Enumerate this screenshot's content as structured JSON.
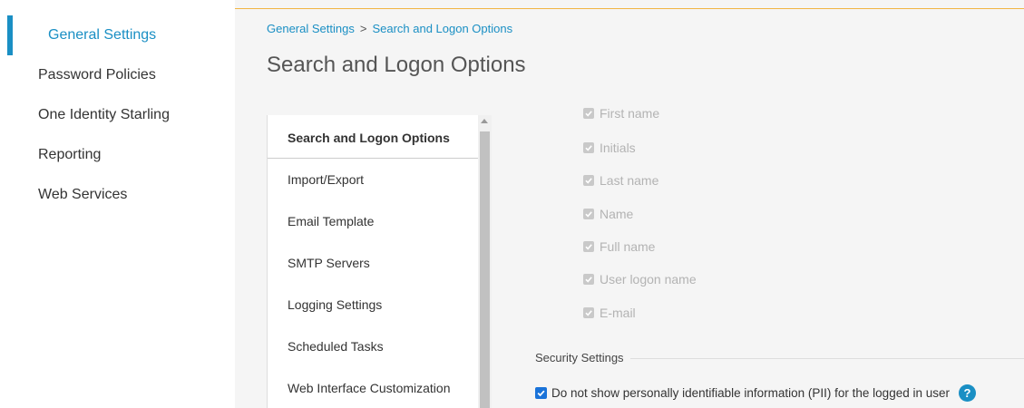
{
  "nav": {
    "items": [
      {
        "label": "General Settings",
        "active": true
      },
      {
        "label": "Password Policies",
        "active": false
      },
      {
        "label": "One Identity Starling",
        "active": false
      },
      {
        "label": "Reporting",
        "active": false
      },
      {
        "label": "Web Services",
        "active": false
      }
    ]
  },
  "breadcrumb": {
    "parent": "General Settings",
    "separator": ">",
    "current": "Search and Logon Options"
  },
  "page": {
    "title": "Search and Logon Options"
  },
  "tabs": [
    {
      "label": "Search and Logon Options",
      "active": true
    },
    {
      "label": "Import/Export",
      "active": false
    },
    {
      "label": "Email Template",
      "active": false
    },
    {
      "label": "SMTP Servers",
      "active": false
    },
    {
      "label": "Logging Settings",
      "active": false
    },
    {
      "label": "Scheduled Tasks",
      "active": false
    },
    {
      "label": "Web Interface Customization",
      "active": false
    }
  ],
  "search_fields": [
    {
      "label": "First name",
      "checked": true,
      "disabled": true
    },
    {
      "label": "Initials",
      "checked": true,
      "disabled": true
    },
    {
      "label": "Last name",
      "checked": true,
      "disabled": true
    },
    {
      "label": "Name",
      "checked": true,
      "disabled": true
    },
    {
      "label": "Full name",
      "checked": true,
      "disabled": true
    },
    {
      "label": "User logon name",
      "checked": true,
      "disabled": true
    },
    {
      "label": "E-mail",
      "checked": true,
      "disabled": true
    }
  ],
  "security": {
    "header": "Security Settings",
    "pii_label": "Do not show personally identifiable information (PII) for the logged in user",
    "pii_checked": true,
    "help_glyph": "?"
  },
  "icons": {
    "checkmark": "checkmark-icon",
    "help": "help-icon",
    "scroll_up": "chevron-up-icon"
  },
  "colors": {
    "accent": "#1a8fc4",
    "checkbox_checked": "#1a73d9",
    "top_border": "#f2b544",
    "disabled": "#b3b3b3"
  }
}
